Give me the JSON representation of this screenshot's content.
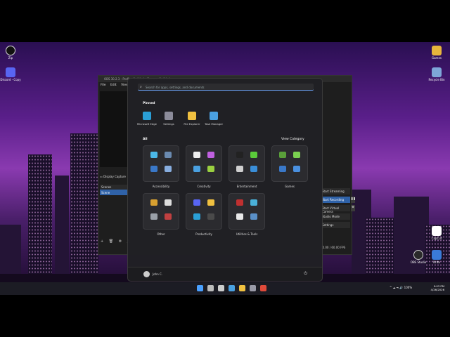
{
  "desktop": {
    "icons_left": [
      {
        "label": "Zip",
        "color": "#111111"
      },
      {
        "label": "Discord - Copy",
        "color": "#5865f2"
      }
    ],
    "icons_right": [
      {
        "label": "Games",
        "color": "#e7b53c"
      },
      {
        "label": "Recycle Bin",
        "color": "#7ea6d8"
      },
      {
        "label": "CapCut",
        "color": "#ffffff"
      },
      {
        "label": "OBS Studio",
        "color": "#2a2a2a"
      },
      {
        "label": "Krita",
        "color": "#3a7ad8"
      }
    ]
  },
  "obs": {
    "title": "OBS 30.2.3 - Profile: Untitled - Scenes: Untitled",
    "menu": [
      "File",
      "Edit",
      "View"
    ],
    "source_label": "Display Capture",
    "scenes_header": "Scenes",
    "scene_item": "Scene",
    "controls": [
      {
        "label": "Start Streaming",
        "active": false
      },
      {
        "label": "Start Recording",
        "active": true
      },
      {
        "label": "Start Virtual Camera",
        "active": false
      },
      {
        "label": "Studio Mode",
        "active": false
      },
      {
        "label": "Settings",
        "active": false
      }
    ],
    "fps": "60.00 / 60.00 FPS",
    "tools": "+ 🗑 ⚙ ⋀"
  },
  "start_menu": {
    "search_placeholder": "Search for apps, settings, and documents",
    "pinned_title": "Pinned",
    "pinned": [
      {
        "label": "Microsoft Edge",
        "color": "#2a9fd6"
      },
      {
        "label": "Settings",
        "color": "#8c8c9a"
      },
      {
        "label": "File Explorer",
        "color": "#f0c040"
      },
      {
        "label": "Task Manager",
        "color": "#4aa0e0"
      }
    ],
    "all_title": "All",
    "view_category": "View Category",
    "folders": [
      {
        "label": "Accessibility",
        "colors": [
          "#4bb8e8",
          "#6a8ab0",
          "#3a78c8",
          "#88aee0"
        ]
      },
      {
        "label": "Creativity",
        "colors": [
          "#eeeeee",
          "#c060e0",
          "#4aa0e0",
          "#9ad040"
        ]
      },
      {
        "label": "Entertainment",
        "colors": [
          "#222222",
          "#5acb3a",
          "#d0d0d0",
          "#3a8ed8"
        ]
      },
      {
        "label": "Games",
        "colors": [
          "#5aa03a",
          "#7ad050",
          "#3a78c8",
          "#4a90e0"
        ]
      },
      {
        "label": "Other",
        "colors": [
          "#d8a030",
          "#dddddd",
          "#9aa0a8",
          "#c04040"
        ]
      },
      {
        "label": "Productivity",
        "colors": [
          "#5865f2",
          "#f0c040",
          "#2a9fd6",
          "#4a4a4a"
        ]
      },
      {
        "label": "Utilities & Tools",
        "colors": [
          "#c03030",
          "#4ab0d8",
          "#e8e8e8",
          "#5a90c8"
        ]
      }
    ],
    "user_name": "John C."
  },
  "taskbar": {
    "apps": [
      {
        "name": "start-icon",
        "color": "#4aa0ff"
      },
      {
        "name": "task-view-icon",
        "color": "#bbbbbb"
      },
      {
        "name": "widgets-icon",
        "color": "#cccccc"
      },
      {
        "name": "task-manager-icon",
        "color": "#4aa0e0"
      },
      {
        "name": "file-explorer-icon",
        "color": "#f0c040"
      },
      {
        "name": "settings-icon",
        "color": "#9a9aa8"
      },
      {
        "name": "chrome-icon",
        "color": "#e04a3a"
      }
    ],
    "tray_text": "^  ☁  ⏦  🔊 100%",
    "time": "9:03 PM",
    "date": "4/26/2026"
  }
}
